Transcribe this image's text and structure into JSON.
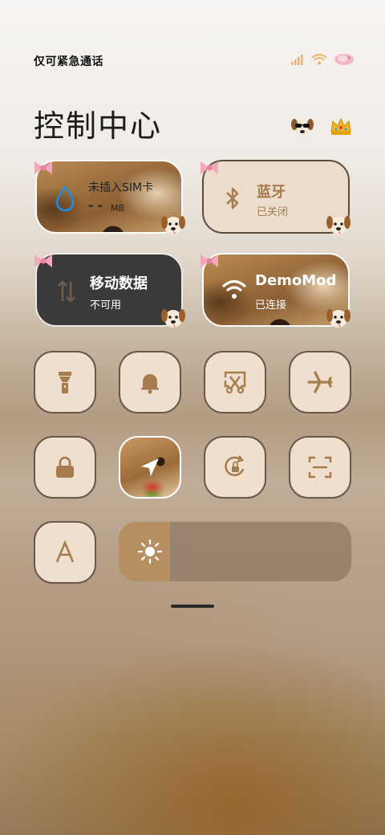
{
  "status": {
    "carrier": "仅可紧急通话",
    "signal_icon": "signal-icon",
    "wifi_icon": "wifi-icon",
    "battery_icon": "battery-icon"
  },
  "header": {
    "title": "控制中心",
    "icons": [
      "dog-sunglasses-icon",
      "crown-icon"
    ]
  },
  "tiles": {
    "data": {
      "title": "未插入SIM卡",
      "sub": "- -",
      "unit": "MB",
      "icon": "water-drop-icon"
    },
    "bluetooth": {
      "title": "蓝牙",
      "sub": "已关闭",
      "icon": "bluetooth-icon"
    },
    "mobile": {
      "title": "移动数据",
      "sub": "不可用",
      "icon": "data-arrows-icon"
    },
    "wifi": {
      "title": "DemoMod",
      "sub": "已连接",
      "icon": "wifi-icon"
    }
  },
  "buttons": [
    {
      "icon": "flashlight-icon"
    },
    {
      "icon": "bell-icon"
    },
    {
      "icon": "screenshot-icon"
    },
    {
      "icon": "airplane-icon"
    },
    {
      "icon": "lock-icon"
    },
    {
      "icon": "location-icon"
    },
    {
      "icon": "rotation-lock-icon"
    },
    {
      "icon": "scan-icon"
    },
    {
      "icon": "font-icon"
    }
  ],
  "brightness": {
    "level": 0.22,
    "icon": "sun-icon"
  },
  "colors": {
    "accent": "#b58e62",
    "tile_bg": "#ecdccb",
    "dark_tile": "#3b3a3a",
    "icon_color": "#a67b4e"
  }
}
